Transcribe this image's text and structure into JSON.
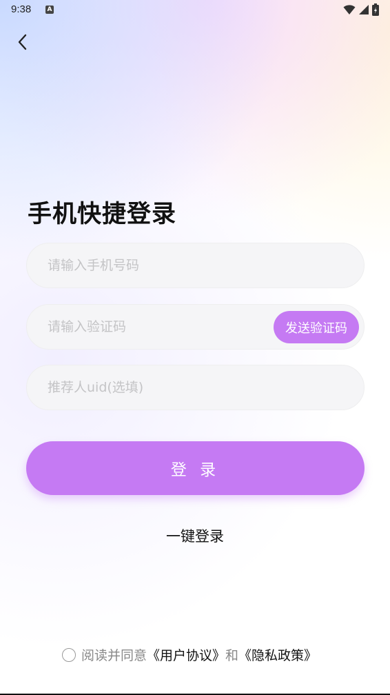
{
  "status_bar": {
    "time": "9:38",
    "notification_badge": "A"
  },
  "page": {
    "title": "手机快捷登录"
  },
  "form": {
    "phone_placeholder": "请输入手机号码",
    "code_placeholder": "请输入验证码",
    "send_code_label": "发送验证码",
    "referrer_placeholder": "推荐人uid(选填)"
  },
  "actions": {
    "login_label": "登 录",
    "one_key_login_label": "一键登录"
  },
  "agreement": {
    "prefix": "阅读并同意",
    "user_agreement": "《用户协议》",
    "and": "和",
    "privacy_policy": "《隐私政策》"
  },
  "colors": {
    "accent": "#c57af3",
    "input_bg": "#f5f5f7",
    "placeholder": "#c4c4c6"
  },
  "icons": {
    "back": "chevron-left-icon",
    "wifi": "wifi-icon",
    "signal": "signal-icon",
    "battery": "battery-icon"
  }
}
